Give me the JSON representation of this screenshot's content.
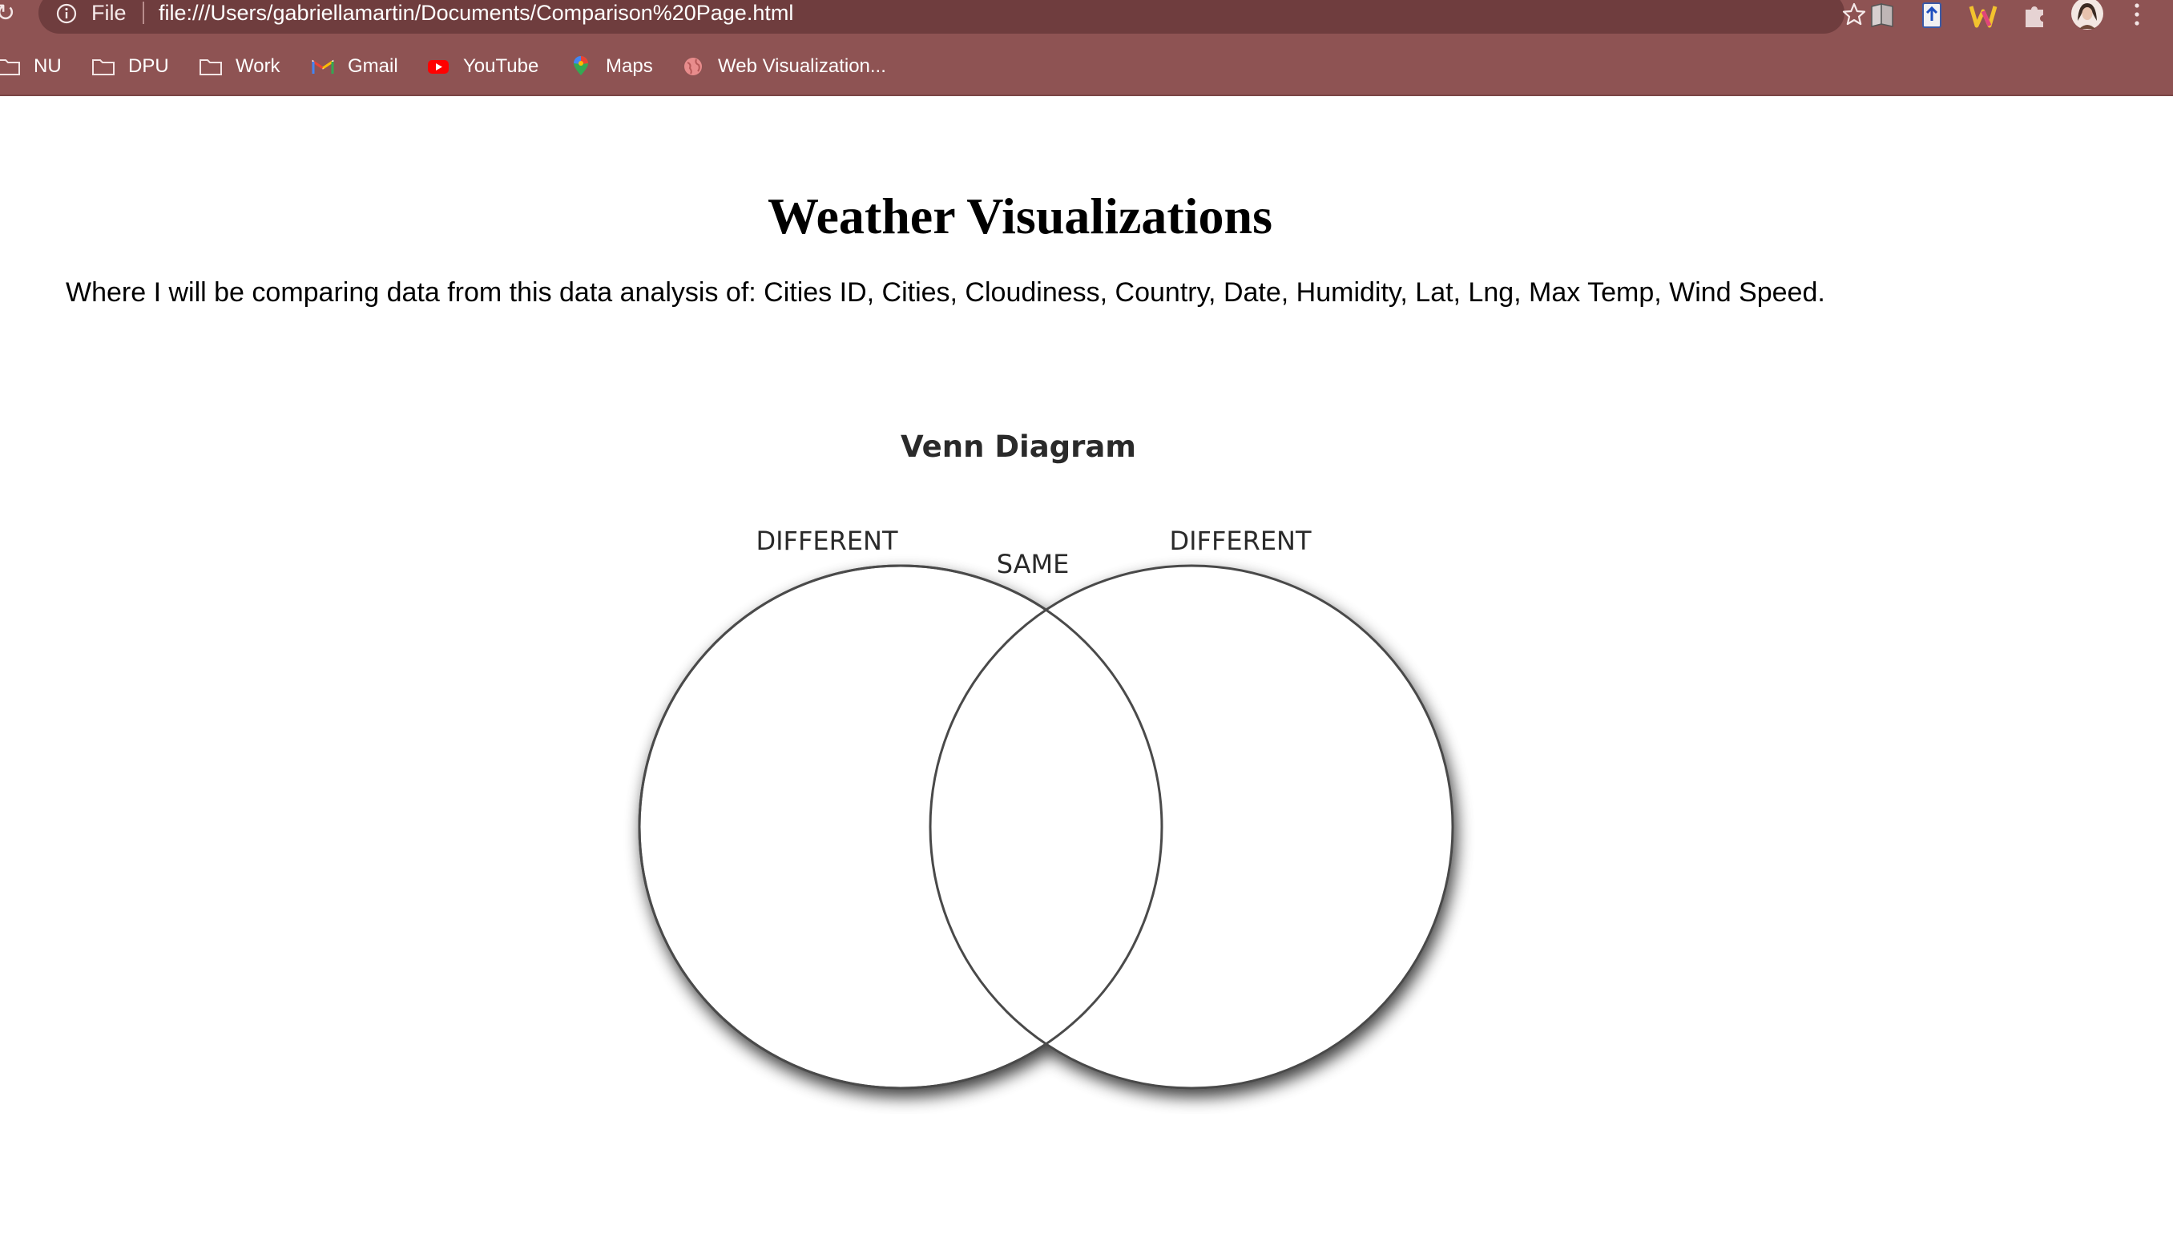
{
  "browser": {
    "site_chip": "File",
    "url": "file:///Users/gabriellamartin/Documents/Comparison%20Page.html",
    "theme_color": "#8e5353",
    "omnibox_color": "#6f3d3e"
  },
  "bookmarks": [
    {
      "label": "NU",
      "icon": "folder-icon"
    },
    {
      "label": "DPU",
      "icon": "folder-icon"
    },
    {
      "label": "Work",
      "icon": "folder-icon"
    },
    {
      "label": "Gmail",
      "icon": "gmail-icon"
    },
    {
      "label": "YouTube",
      "icon": "youtube-icon"
    },
    {
      "label": "Maps",
      "icon": "maps-icon"
    },
    {
      "label": "Web Visualization...",
      "icon": "globe-icon"
    }
  ],
  "page": {
    "title": "Weather Visualizations",
    "description": "Where I will be comparing data from this data analysis of: Cities ID, Cities, Cloudiness, Country, Date, Humidity, Lat, Lng, Max Temp, Wind Speed."
  },
  "venn": {
    "heading": "Venn Diagram",
    "left_label": "DIFFERENT",
    "middle_label": "SAME",
    "right_label": "DIFFERENT"
  }
}
